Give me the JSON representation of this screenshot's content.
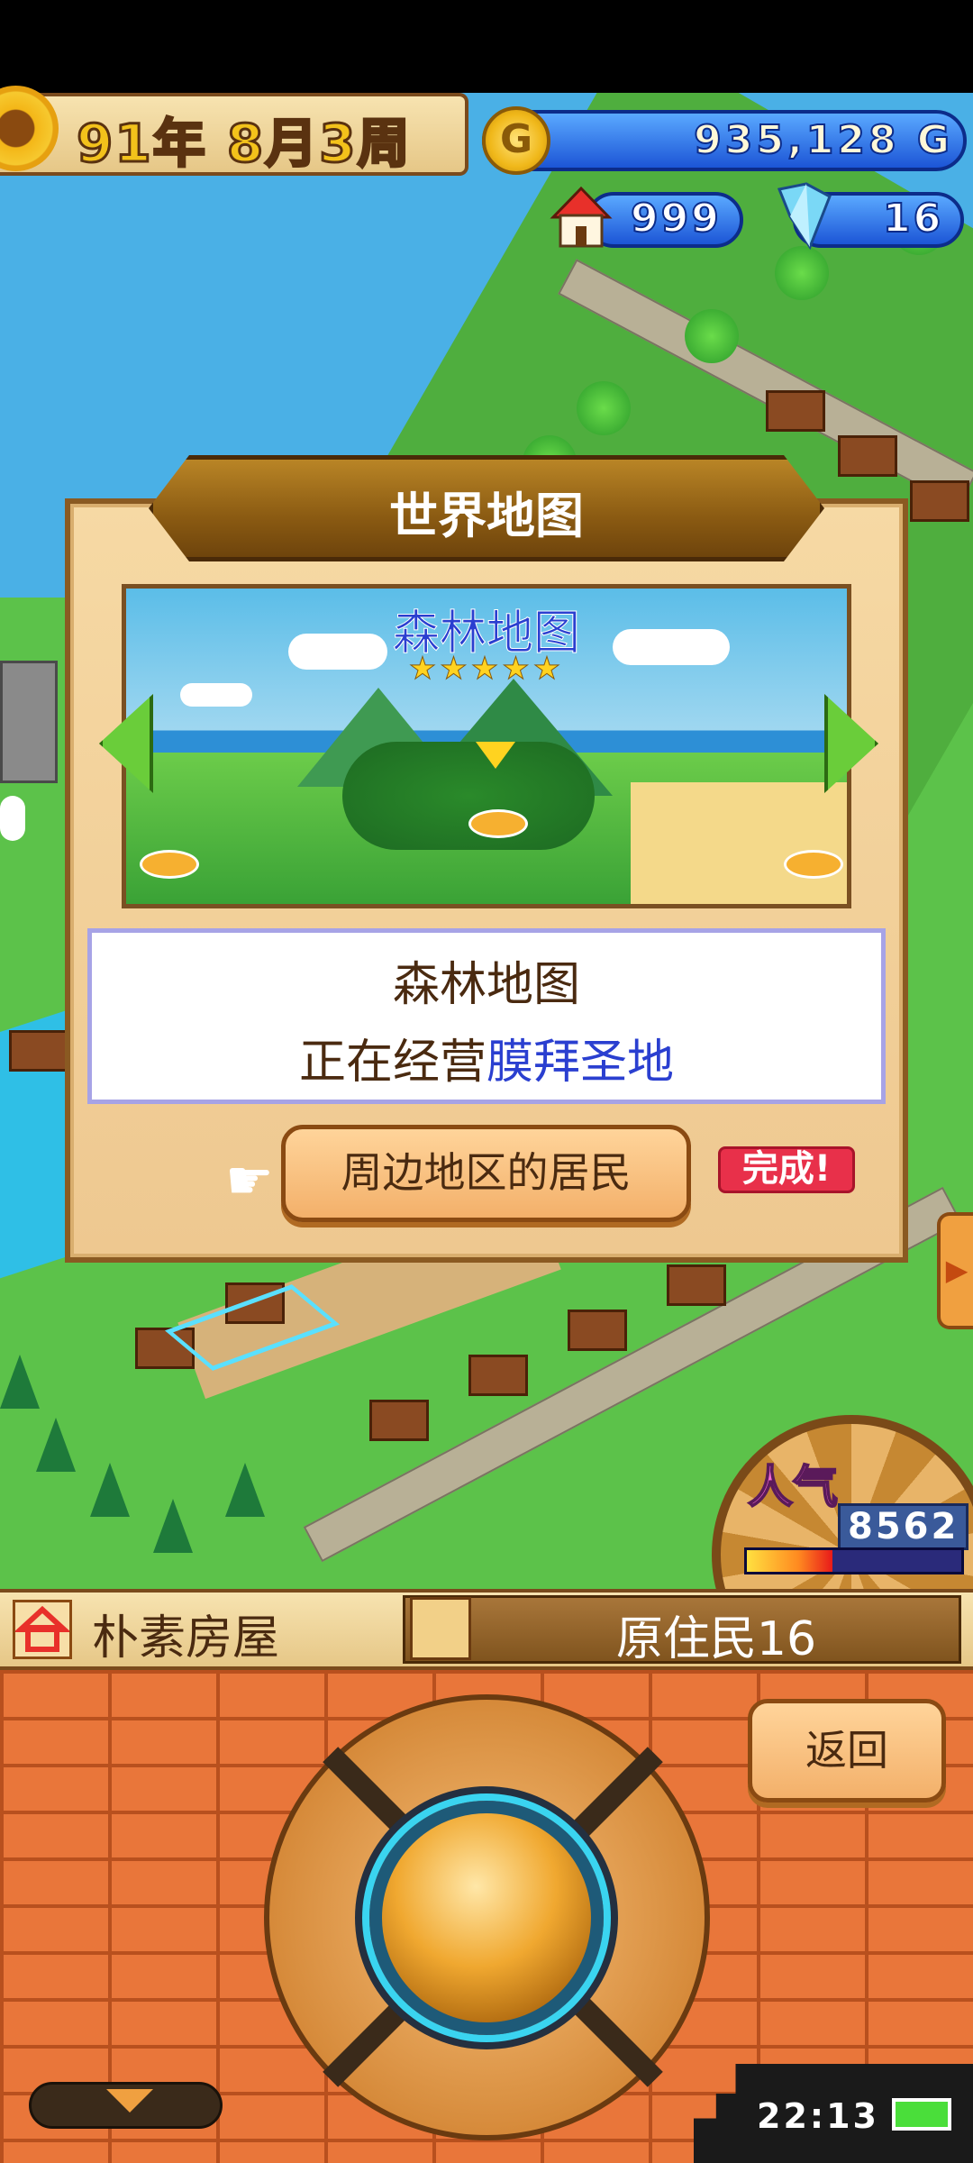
{
  "hud": {
    "date": "91年 8月3周",
    "gold": "935,128 G",
    "gold_coin_letter": "G",
    "houses": "999",
    "crystals": "16"
  },
  "dialog": {
    "title": "世界地图",
    "map_name": "森林地图",
    "stars": "★★★★★",
    "info_line1": "森林地图",
    "info_line2_prefix": "正在经营",
    "info_line2_highlight": "膜拜圣地",
    "residents_button": "周边地区的居民",
    "complete_badge": "完成!"
  },
  "popularity": {
    "label": "人气",
    "value": "8562",
    "level": 0.4
  },
  "status": {
    "left_label": "朴素房屋",
    "right_label": "原住民16"
  },
  "controls": {
    "back_button": "返回"
  },
  "system": {
    "clock": "22:13"
  },
  "colors": {
    "accent_blue": "#2a3fd0",
    "hud_blue": "#1c55d6",
    "complete_red": "#e8304a",
    "brick": "#e9763a"
  },
  "icons": [
    "sun-icon",
    "gold-coin-icon",
    "house-icon",
    "crystal-icon",
    "arrow-left-icon",
    "arrow-right-icon",
    "hand-pointer-icon",
    "chevron-down-icon",
    "battery-icon"
  ]
}
